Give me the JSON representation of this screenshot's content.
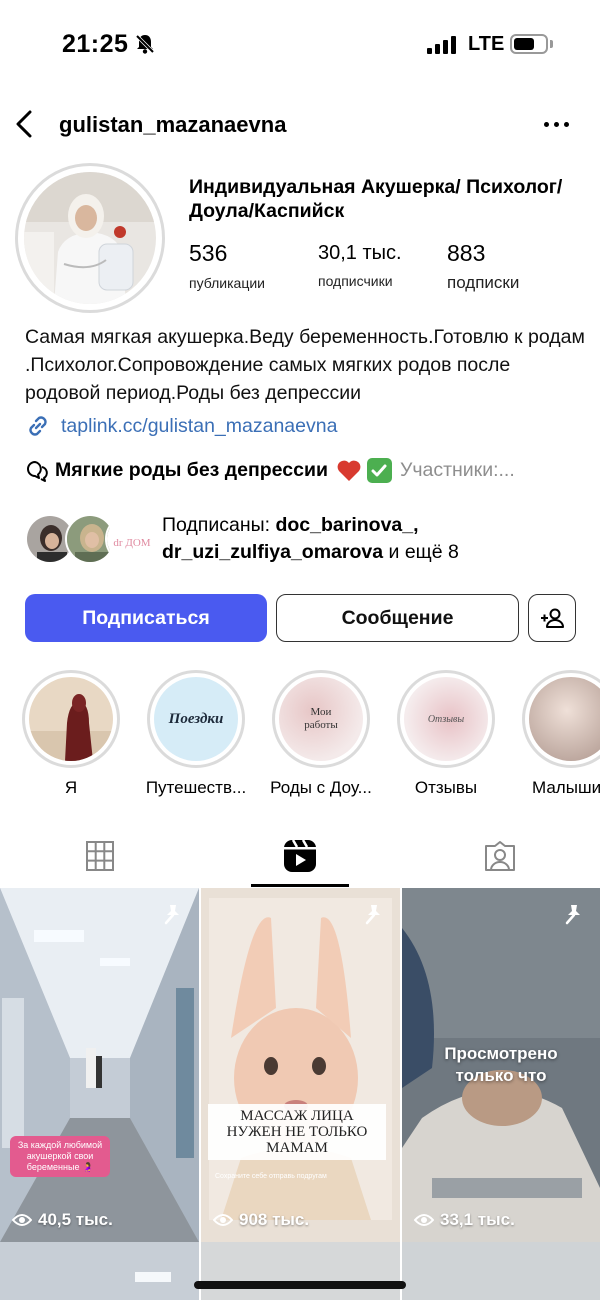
{
  "status_bar": {
    "time": "21:25",
    "network": "LTE"
  },
  "header": {
    "username": "gulistan_mazanaevna"
  },
  "profile": {
    "name": "Индивидуальная Акушерка/ Психолог/Доула/Каспийск",
    "stats": [
      {
        "value": "536",
        "label": "публикации"
      },
      {
        "value": "30,1 тыс.",
        "label": "подписчики"
      },
      {
        "value": "883",
        "label": "подписки"
      }
    ],
    "bio": "Самая мягкая акушерка.Веду беременность.Готовлю к родам .Психолог.Сопровождение самых мягких родов после родовой период.Роды без депрессии",
    "link": "taplink.cc/gulistan_mazanaevna",
    "thread": {
      "title": "Мягкие роды без депрессии",
      "members": "Участники:..."
    },
    "followed_by": {
      "prefix": "Подписаны: ",
      "user1": "doc_barinova_",
      "user2": "dr_uzi_zulfiya_omarova",
      "suffix": " и ещё 8"
    }
  },
  "actions": {
    "follow": "Подписаться",
    "message": "Сообщение"
  },
  "highlights": [
    {
      "label": "Я",
      "icon": "photo"
    },
    {
      "label": "Путешеств...",
      "cover_text": "Поездки"
    },
    {
      "label": "Роды с Доу...",
      "cover_text": "Мои работы"
    },
    {
      "label": "Отзывы",
      "cover_text": "Отзывы"
    },
    {
      "label": "Малыши",
      "icon": "photo"
    }
  ],
  "tabs": [
    {
      "name": "grid",
      "icon": "grid-icon"
    },
    {
      "name": "reels",
      "icon": "reels-icon",
      "active": true
    },
    {
      "name": "tagged",
      "icon": "tagged-icon"
    }
  ],
  "reels": [
    {
      "views": "40,5 тыс.",
      "caption": "За каждой любимой акушеркой свои беременные 🤰",
      "pinned": true
    },
    {
      "views": "908 тыс.",
      "caption": "МАССАЖ ЛИЦА НУЖЕН НЕ ТОЛЬКО МАМАМ",
      "subcaption": "Сохраните себе отправь подругам",
      "pinned": true
    },
    {
      "views": "33,1 тыс.",
      "overlay": "Просмотрено только что",
      "pinned": true
    }
  ],
  "colors": {
    "primary_button": "#4a5af0",
    "link": "#3b6fb6",
    "muted": "#8e8e8e"
  }
}
